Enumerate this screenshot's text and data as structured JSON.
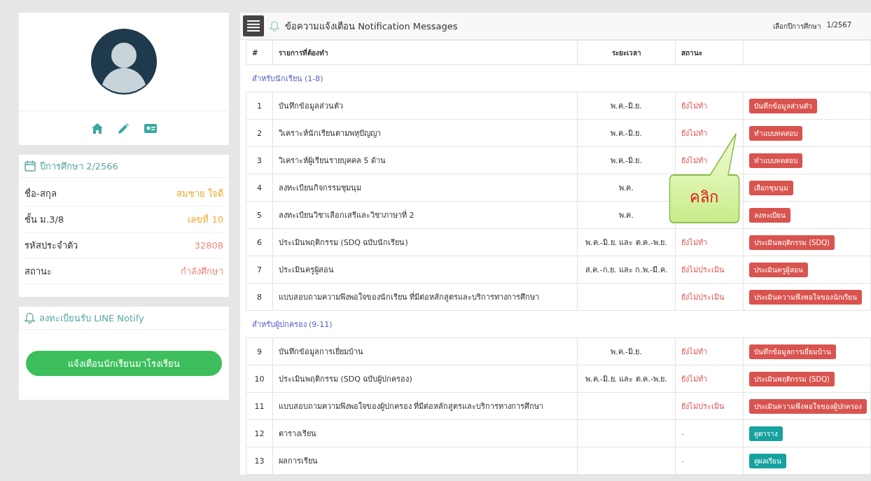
{
  "profile": {
    "actions": [
      {
        "kind": "home"
      },
      {
        "kind": "edit"
      },
      {
        "kind": "id-card"
      }
    ]
  },
  "student_card": {
    "title": "ปีการศึกษา 2/2566",
    "rows": [
      {
        "label": "ชื่อ-สกุล",
        "value": "สมชาย ใจดี",
        "color": "#f0a830"
      },
      {
        "label": "ชั้น ม.3/8",
        "value": "เลขที่ 10",
        "color": "#f0a830"
      },
      {
        "label": "รหัสประจำตัว",
        "value": "32808",
        "color": "#ef8a7a"
      },
      {
        "label": "สถานะ",
        "value": "กำลังศึกษา",
        "color": "#ef8a7a"
      }
    ]
  },
  "line_card": {
    "title": "ลงทะเบียนรับ LINE Notify",
    "button": "แจ้งเตือนนักเรียนมาโรงเรียน"
  },
  "panel": {
    "title": "ข้อความแจ้งเตือน Notification Messages",
    "year_label": "เลือกปีการศึกษา",
    "year": "1/2567",
    "columns": [
      "#",
      "รายการที่ต้องทำ",
      "ระยะเวลา",
      "สถานะ"
    ],
    "groups": [
      {
        "title": "สำหรับนักเรียน (1-8)",
        "rows": [
          {
            "no": "1",
            "task": "บันทึกข้อมูลส่วนตัว",
            "period": "พ.ค.-มิ.ย.",
            "status": "ยังไม่ทำ",
            "action": "บันทึกข้อมูลส่วนตัว",
            "kind": "danger"
          },
          {
            "no": "2",
            "task": "วิเคราะห์นักเรียนตามพหุปัญญา",
            "period": "พ.ค.-มิ.ย.",
            "status": "ยังไม่ทำ",
            "action": "ทำแบบทดสอบ",
            "kind": "danger"
          },
          {
            "no": "3",
            "task": "วิเคราะห์ผู้เรียนรายบุคคล 5 ด้าน",
            "period": "พ.ค.-มิ.ย.",
            "status": "ยังไม่ทำ",
            "action": "ทำแบบทดสอบ",
            "kind": "danger"
          },
          {
            "no": "4",
            "task": "ลงทะเบียนกิจกรรมชุมนุม",
            "period": "พ.ค.",
            "action": "เลือกชุมนุม",
            "kind": "danger"
          },
          {
            "no": "5",
            "task": "ลงทะเบียนวิชาเลือกเสรีและวิชาภาษาที่ 2",
            "period": "พ.ค.",
            "action": "ลงทะเบียน",
            "kind": "danger"
          },
          {
            "no": "6",
            "task": "ประเมินพฤติกรรม (SDQ ฉบับนักเรียน)",
            "period": "พ.ค.-มิ.ย. และ ต.ค.-พ.ย.",
            "status": "ยังไม่ทำ",
            "action": "ประเมินพฤติกรรม (SDQ)",
            "kind": "danger"
          },
          {
            "no": "7",
            "task": "ประเมินครูผู้สอน",
            "period": "ส.ค.-ก.ย. และ ก.พ.-มี.ค.",
            "status": "ยังไม่ประเมิน",
            "action": "ประเมินครูผู้สอน",
            "kind": "danger"
          },
          {
            "no": "8",
            "task": "แบบสอบถามความพึงพอใจของนักเรียน ที่มีต่อหลักสูตรและบริการทางการศึกษา",
            "status": "ยังไม่ประเมิน",
            "action": "ประเมินความพึงพอใจของนักเรียน",
            "kind": "danger"
          }
        ]
      },
      {
        "title": "สำหรับผู้ปกครอง (9-11)",
        "rows": [
          {
            "no": "9",
            "task": "บันทึกข้อมูลการเยี่ยมบ้าน",
            "period": "พ.ค.-มิ.ย.",
            "status": "ยังไม่ทำ",
            "action": "บันทึกข้อมูลการเยี่ยมบ้าน",
            "kind": "danger"
          },
          {
            "no": "10",
            "task": "ประเมินพฤติกรรม (SDQ ฉบับผู้ปกครอง)",
            "period": "พ.ค.-มิ.ย. และ ต.ค.-พ.ย.",
            "status": "ยังไม่ทำ",
            "action": "ประเมินพฤติกรรม (SDQ)",
            "kind": "danger"
          },
          {
            "no": "11",
            "task": "แบบสอบถามความพึงพอใจของผู้ปกครอง ที่มีต่อหลักสูตรและบริการทางการศึกษา",
            "status": "ยังไม่ประเมิน",
            "action": "ประเมินความพึงพอใจของผู้ปกครอง",
            "kind": "danger"
          },
          {
            "no": "12",
            "task": "ตารางเรียน",
            "status": "-",
            "action": "ดูตาราง",
            "kind": "info"
          },
          {
            "no": "13",
            "task": "ผลการเรียน",
            "status": "-",
            "action": "ดูผลเรียน",
            "kind": "info"
          }
        ]
      }
    ]
  },
  "callout": {
    "text": "คลิก"
  }
}
